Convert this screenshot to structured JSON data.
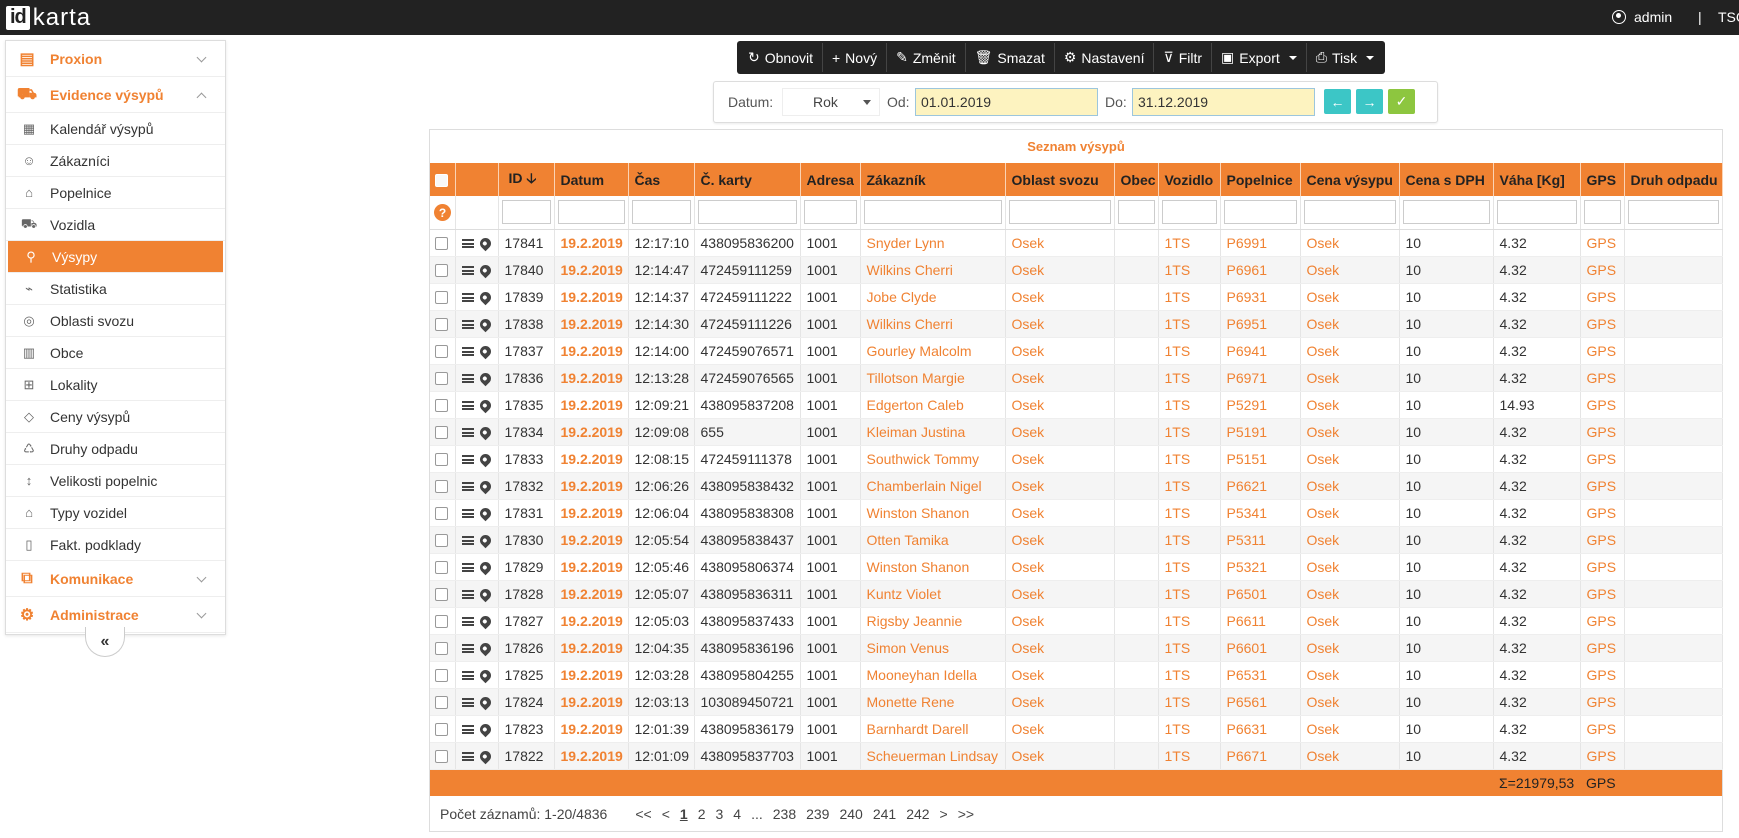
{
  "app": {
    "logo_id": "id",
    "logo_karta": "karta",
    "user": "admin",
    "separator": "|",
    "tenant": "TSC"
  },
  "sidebar": {
    "groups": [
      {
        "label": "Proxion",
        "icon": "id-card-icon"
      },
      {
        "label": "Evidence výsypů",
        "icon": "truck-icon"
      },
      {
        "label": "Komunikace",
        "icon": "network-icon"
      },
      {
        "label": "Administrace",
        "icon": "gear-icon"
      }
    ],
    "items": [
      {
        "label": "Kalendář výsypů",
        "icon": "calendar-icon"
      },
      {
        "label": "Zákazníci",
        "icon": "contact-icon"
      },
      {
        "label": "Popelnice",
        "icon": "trash-bin-icon"
      },
      {
        "label": "Vozidla",
        "icon": "vehicle-icon"
      },
      {
        "label": "Výsypy",
        "icon": "dump-icon",
        "active": true
      },
      {
        "label": "Statistika",
        "icon": "chart-icon"
      },
      {
        "label": "Oblasti svozu",
        "icon": "area-icon"
      },
      {
        "label": "Obce",
        "icon": "city-icon"
      },
      {
        "label": "Lokality",
        "icon": "map-icon"
      },
      {
        "label": "Ceny výsypů",
        "icon": "tag-icon"
      },
      {
        "label": "Druhy odpadu",
        "icon": "recycle-icon"
      },
      {
        "label": "Velikosti popelnic",
        "icon": "size-icon"
      },
      {
        "label": "Typy vozidel",
        "icon": "garage-icon"
      },
      {
        "label": "Fakt. podklady",
        "icon": "invoice-icon"
      }
    ],
    "collapse_label": "«"
  },
  "toolbar": [
    {
      "label": "Obnovit",
      "icon": "refresh-icon"
    },
    {
      "label": "Nový",
      "icon": "plus-icon"
    },
    {
      "label": "Změnit",
      "icon": "pencil-icon"
    },
    {
      "label": "Smazat",
      "icon": "trash-icon"
    },
    {
      "label": "Nastavení",
      "icon": "settings-icon"
    },
    {
      "label": "Filtr",
      "icon": "filter-icon"
    },
    {
      "label": "Export",
      "icon": "excel-icon",
      "dropdown": true
    },
    {
      "label": "Tisk",
      "icon": "printer-icon",
      "dropdown": true
    }
  ],
  "datebar": {
    "datum_label": "Datum:",
    "period": "Rok",
    "od_label": "Od:",
    "od_value": "01.01.2019",
    "do_label": "Do:",
    "do_value": "31.12.2019",
    "prev_color": "#3cc6c6",
    "next_color": "#3cc6c6",
    "ok_color": "#8dc63f"
  },
  "grid": {
    "title": "Seznam výsypů",
    "columns": [
      "ID",
      "Datum",
      "Čas",
      "Č. karty",
      "Adresa",
      "Zákazník",
      "Oblast svozu",
      "Obec",
      "Vozidlo",
      "Popelnice",
      "Cena výsypu",
      "Cena s DPH",
      "Váha [Kg]",
      "GPS",
      "Druh odpadu"
    ],
    "rows": [
      [
        "17841",
        "19.2.2019",
        "12:17:10",
        "438095836200",
        "1001",
        "Snyder Lynn",
        "Osek",
        "",
        "1TS",
        "P6991",
        "Osek",
        "10",
        "4.32",
        "GPS",
        ""
      ],
      [
        "17840",
        "19.2.2019",
        "12:14:47",
        "472459111259",
        "1001",
        "Wilkins Cherri",
        "Osek",
        "",
        "1TS",
        "P6961",
        "Osek",
        "10",
        "4.32",
        "GPS",
        ""
      ],
      [
        "17839",
        "19.2.2019",
        "12:14:37",
        "472459111222",
        "1001",
        "Jobe Clyde",
        "Osek",
        "",
        "1TS",
        "P6931",
        "Osek",
        "10",
        "4.32",
        "GPS",
        ""
      ],
      [
        "17838",
        "19.2.2019",
        "12:14:30",
        "472459111226",
        "1001",
        "Wilkins Cherri",
        "Osek",
        "",
        "1TS",
        "P6951",
        "Osek",
        "10",
        "4.32",
        "GPS",
        ""
      ],
      [
        "17837",
        "19.2.2019",
        "12:14:00",
        "472459076571",
        "1001",
        "Gourley Malcolm",
        "Osek",
        "",
        "1TS",
        "P6941",
        "Osek",
        "10",
        "4.32",
        "GPS",
        ""
      ],
      [
        "17836",
        "19.2.2019",
        "12:13:28",
        "472459076565",
        "1001",
        "Tillotson Margie",
        "Osek",
        "",
        "1TS",
        "P6971",
        "Osek",
        "10",
        "4.32",
        "GPS",
        ""
      ],
      [
        "17835",
        "19.2.2019",
        "12:09:21",
        "438095837208",
        "1001",
        "Edgerton Caleb",
        "Osek",
        "",
        "1TS",
        "P5291",
        "Osek",
        "10",
        "14.93",
        "GPS",
        ""
      ],
      [
        "17834",
        "19.2.2019",
        "12:09:08",
        "655",
        "1001",
        "Kleiman Justina",
        "Osek",
        "",
        "1TS",
        "P5191",
        "Osek",
        "10",
        "4.32",
        "GPS",
        ""
      ],
      [
        "17833",
        "19.2.2019",
        "12:08:15",
        "472459111378",
        "1001",
        "Southwick Tommy",
        "Osek",
        "",
        "1TS",
        "P5151",
        "Osek",
        "10",
        "4.32",
        "GPS",
        ""
      ],
      [
        "17832",
        "19.2.2019",
        "12:06:26",
        "438095838432",
        "1001",
        "Chamberlain Nigel",
        "Osek",
        "",
        "1TS",
        "P6621",
        "Osek",
        "10",
        "4.32",
        "GPS",
        ""
      ],
      [
        "17831",
        "19.2.2019",
        "12:06:04",
        "438095838308",
        "1001",
        "Winston Shanon",
        "Osek",
        "",
        "1TS",
        "P5341",
        "Osek",
        "10",
        "4.32",
        "GPS",
        ""
      ],
      [
        "17830",
        "19.2.2019",
        "12:05:54",
        "438095838437",
        "1001",
        "Otten Tamika",
        "Osek",
        "",
        "1TS",
        "P5311",
        "Osek",
        "10",
        "4.32",
        "GPS",
        ""
      ],
      [
        "17829",
        "19.2.2019",
        "12:05:46",
        "438095806374",
        "1001",
        "Winston Shanon",
        "Osek",
        "",
        "1TS",
        "P5321",
        "Osek",
        "10",
        "4.32",
        "GPS",
        ""
      ],
      [
        "17828",
        "19.2.2019",
        "12:05:07",
        "438095836311",
        "1001",
        "Kuntz Violet",
        "Osek",
        "",
        "1TS",
        "P6501",
        "Osek",
        "10",
        "4.32",
        "GPS",
        ""
      ],
      [
        "17827",
        "19.2.2019",
        "12:05:03",
        "438095837433",
        "1001",
        "Rigsby Jeannie",
        "Osek",
        "",
        "1TS",
        "P6611",
        "Osek",
        "10",
        "4.32",
        "GPS",
        ""
      ],
      [
        "17826",
        "19.2.2019",
        "12:04:35",
        "438095836196",
        "1001",
        "Simon Venus",
        "Osek",
        "",
        "1TS",
        "P6601",
        "Osek",
        "10",
        "4.32",
        "GPS",
        ""
      ],
      [
        "17825",
        "19.2.2019",
        "12:03:28",
        "438095804255",
        "1001",
        "Mooneyhan Idella",
        "Osek",
        "",
        "1TS",
        "P6531",
        "Osek",
        "10",
        "4.32",
        "GPS",
        ""
      ],
      [
        "17824",
        "19.2.2019",
        "12:03:13",
        "103089450721",
        "1001",
        "Monette Rene",
        "Osek",
        "",
        "1TS",
        "P6561",
        "Osek",
        "10",
        "4.32",
        "GPS",
        ""
      ],
      [
        "17823",
        "19.2.2019",
        "12:01:39",
        "438095836179",
        "1001",
        "Barnhardt Darell",
        "Osek",
        "",
        "1TS",
        "P6631",
        "Osek",
        "10",
        "4.32",
        "GPS",
        ""
      ],
      [
        "17822",
        "19.2.2019",
        "12:01:09",
        "438095837703",
        "1001",
        "Scheuerman Lindsay",
        "Osek",
        "",
        "1TS",
        "P6671",
        "Osek",
        "10",
        "4.32",
        "GPS",
        ""
      ]
    ],
    "sum_weight": "Σ=21979,53",
    "sum_gps": "GPS",
    "help_label": "?"
  },
  "pager": {
    "count_text": "Počet záznamů: 1-20/4836",
    "links": [
      "<<",
      "<",
      "1",
      "2",
      "3",
      "4",
      "...",
      "238",
      "239",
      "240",
      "241",
      "242",
      ">",
      ">>"
    ],
    "current": "1"
  }
}
